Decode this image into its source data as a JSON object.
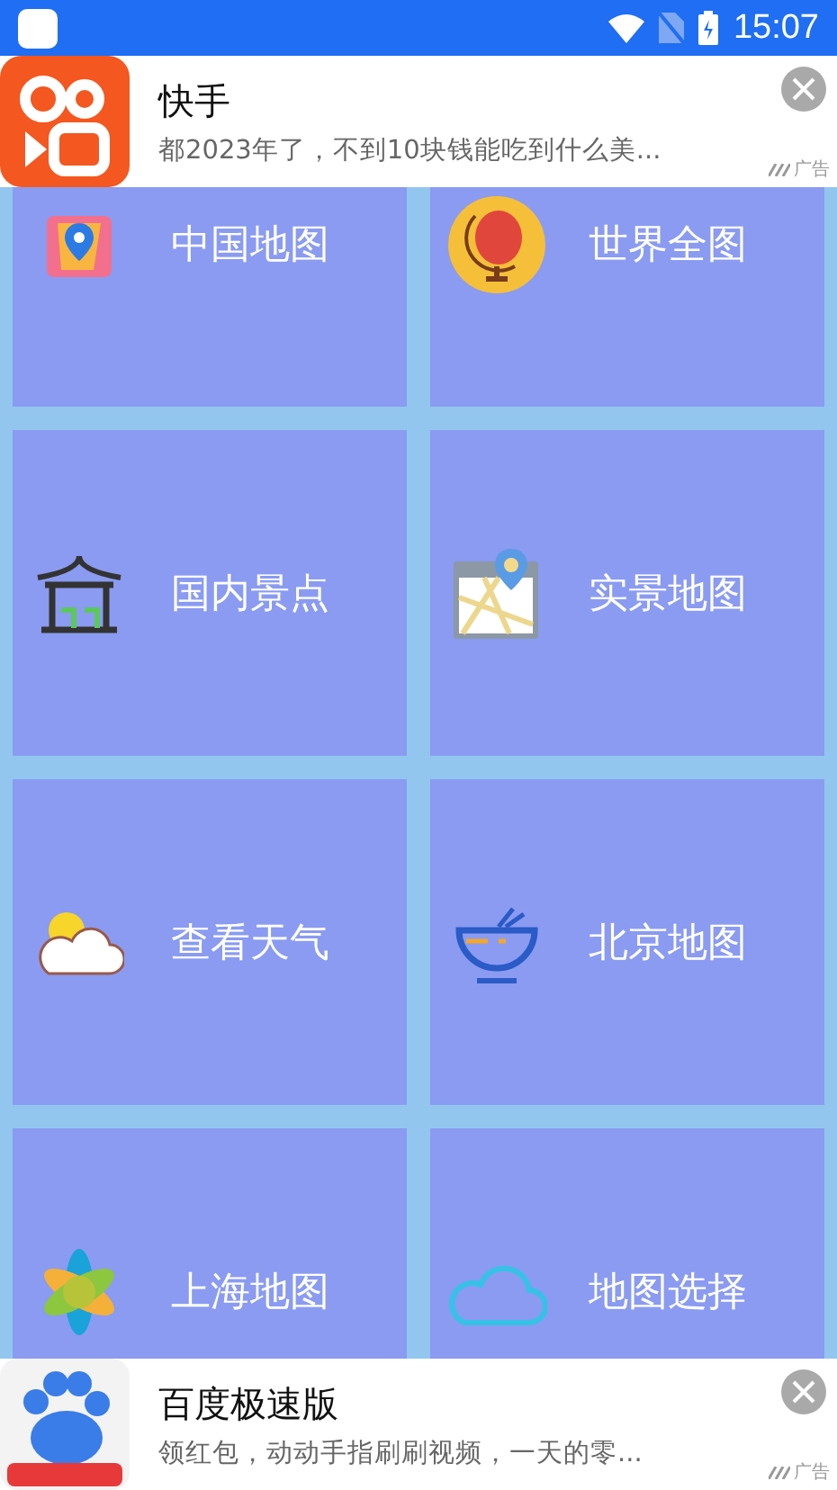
{
  "status_bar": {
    "time": "15:07"
  },
  "top_ad": {
    "kind": "video",
    "title": "快手",
    "description": "都2023年了，不到10块钱能吃到什么美...",
    "tag": "广告"
  },
  "tiles": [
    {
      "label": "中国地图",
      "kind": "map"
    },
    {
      "label": "世界全图",
      "kind": "globe"
    },
    {
      "label": "国内景点",
      "kind": "pavilion"
    },
    {
      "label": "实景地图",
      "kind": "street"
    },
    {
      "label": "查看天气",
      "kind": "weather"
    },
    {
      "label": "北京地图",
      "kind": "bowl"
    },
    {
      "label": "上海地图",
      "kind": "flower"
    },
    {
      "label": "地图选择",
      "kind": "cloud"
    }
  ],
  "bottom_ad": {
    "kind": "paw",
    "title": "百度极速版",
    "description": "领红包，动动手指刷刷视频，一天的零...",
    "tag": "广告"
  }
}
